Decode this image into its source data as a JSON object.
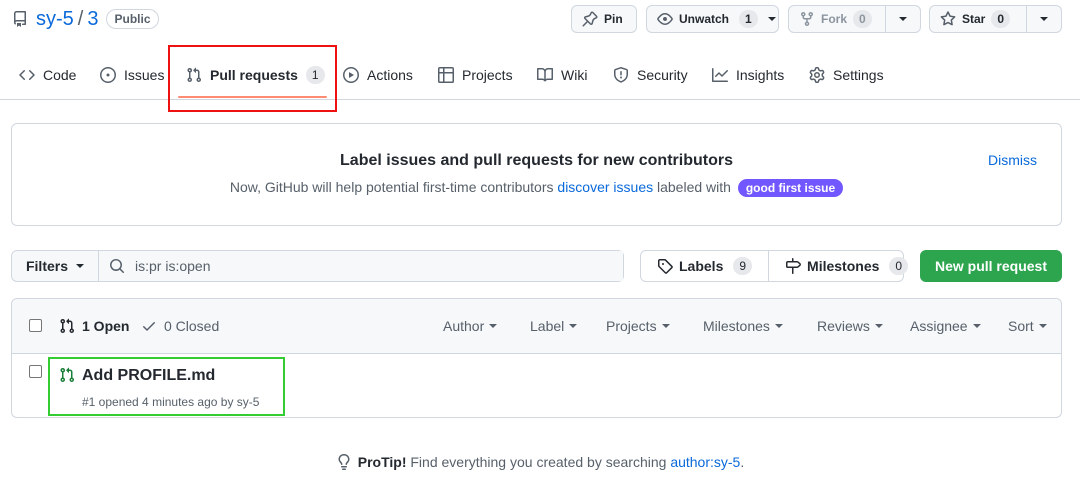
{
  "repo": {
    "owner": "sy-5",
    "separator": "/",
    "name": "3",
    "visibility": "Public"
  },
  "header_buttons": {
    "pin": "Pin",
    "unwatch": "Unwatch",
    "unwatch_count": "1",
    "fork": "Fork",
    "fork_count": "0",
    "star": "Star",
    "star_count": "0"
  },
  "tabs": [
    {
      "label": "Code",
      "icon": "code-icon"
    },
    {
      "label": "Issues",
      "icon": "issue-opened-icon"
    },
    {
      "label": "Pull requests",
      "icon": "git-pull-request-icon",
      "count": "1",
      "active": true
    },
    {
      "label": "Actions",
      "icon": "play-icon"
    },
    {
      "label": "Projects",
      "icon": "table-icon"
    },
    {
      "label": "Wiki",
      "icon": "book-icon"
    },
    {
      "label": "Security",
      "icon": "shield-icon"
    },
    {
      "label": "Insights",
      "icon": "graph-icon"
    },
    {
      "label": "Settings",
      "icon": "gear-icon"
    }
  ],
  "banner": {
    "title": "Label issues and pull requests for new contributors",
    "text_before": "Now, GitHub will help potential first-time contributors",
    "link": "discover issues",
    "text_after": "labeled with",
    "label": "good first issue",
    "dismiss": "Dismiss"
  },
  "filters": {
    "button": "Filters",
    "query": "is:pr is:open"
  },
  "labels": {
    "label": "Labels",
    "count": "9"
  },
  "milestones": {
    "label": "Milestones",
    "count": "0"
  },
  "new_pr": "New pull request",
  "list": {
    "open": "1 Open",
    "closed": "0 Closed",
    "sort_menus": [
      "Author",
      "Label",
      "Projects",
      "Milestones",
      "Reviews",
      "Assignee",
      "Sort"
    ],
    "items": [
      {
        "title": "Add PROFILE.md",
        "meta": "#1 opened 4 minutes ago by sy-5"
      }
    ]
  },
  "protip": {
    "bold": "ProTip!",
    "text": "Find everything you created by searching",
    "link": "author:sy-5",
    "end": "."
  },
  "colors": {
    "accent": "#0969da",
    "primary_button": "#2da44e",
    "label_good_first_issue": "#7057ff",
    "highlight_red": "#ee1111",
    "highlight_green": "#33cc33"
  }
}
